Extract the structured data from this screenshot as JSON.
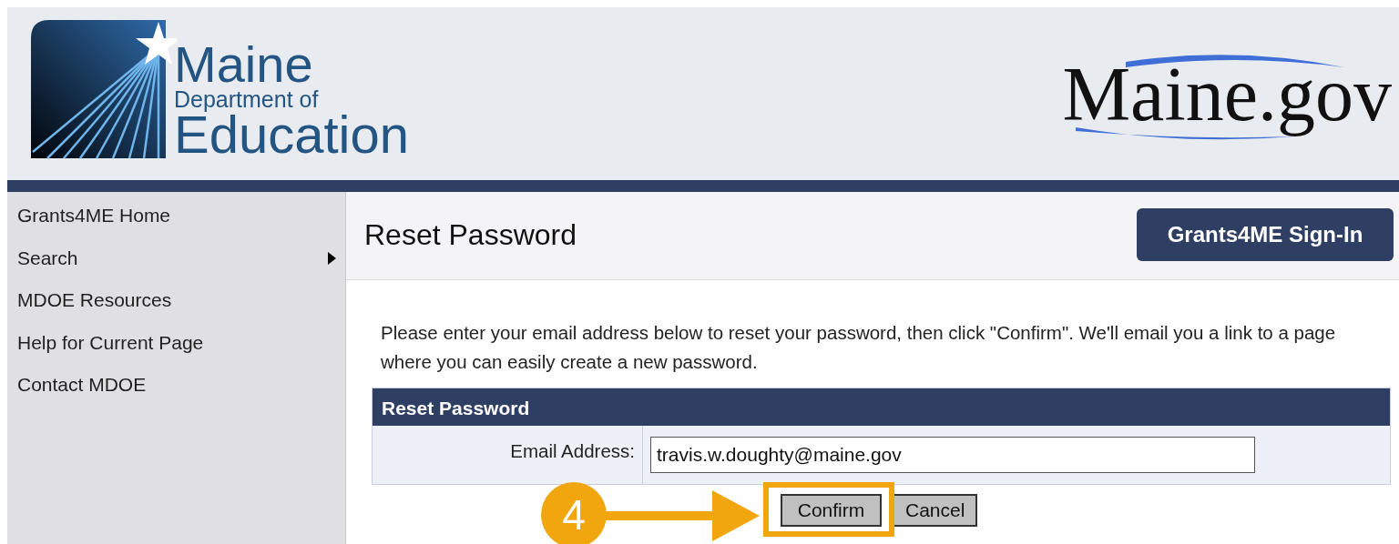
{
  "header": {
    "logo_lines": [
      "Maine",
      "Department of",
      "Education"
    ],
    "site_logo": "Maine.gov"
  },
  "sidebar": {
    "items": [
      {
        "label": "Grants4ME Home",
        "kind": "link"
      },
      {
        "label": "Search",
        "kind": "submenu"
      },
      {
        "label": "MDOE Resources",
        "kind": "link"
      },
      {
        "label": "Help for Current Page",
        "kind": "link"
      },
      {
        "label": "Contact MDOE",
        "kind": "link"
      }
    ]
  },
  "page": {
    "title": "Reset Password",
    "sign_in_button": "Grants4ME Sign-In",
    "instructions": "Please enter your email address below to reset your password, then click \"Confirm\". We'll email you a link to a page where you can easily create a new password."
  },
  "form": {
    "heading": "Reset Password",
    "fields": [
      {
        "label": "Email Address:",
        "value": "travis.w.doughty@maine.gov"
      }
    ],
    "buttons": [
      "Confirm",
      "Cancel"
    ]
  },
  "callout": {
    "step": "4"
  }
}
